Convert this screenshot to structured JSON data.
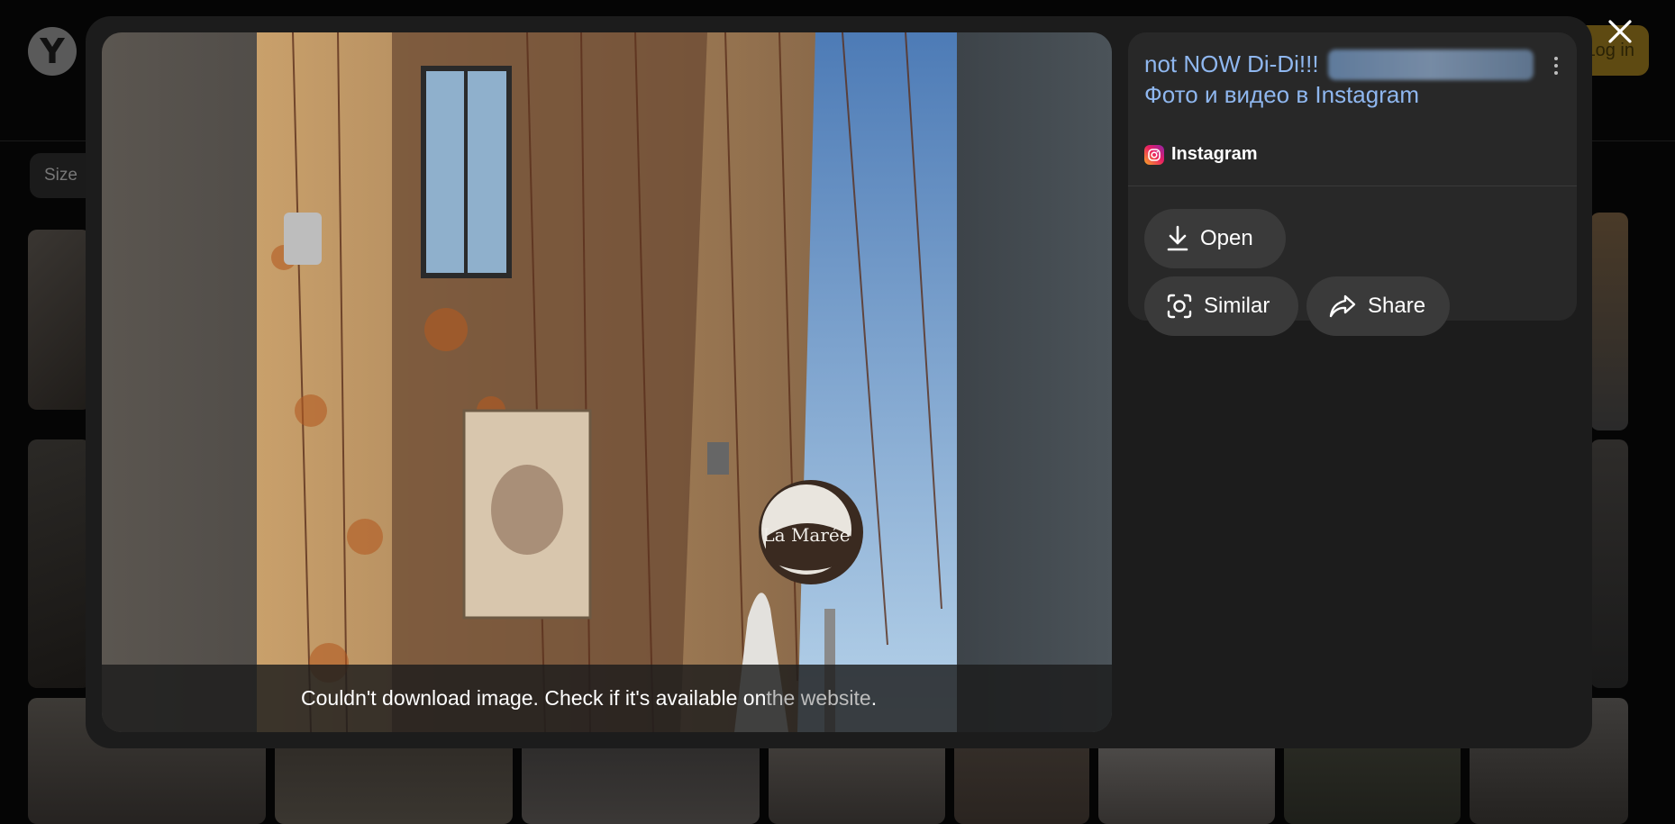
{
  "background": {
    "logo_letter": "Y",
    "size_chip": "Size",
    "login_label": "Log in"
  },
  "viewer": {
    "error_text": "Couldn't download image. Check if it's available on ",
    "error_link": "the website",
    "error_tail": ".",
    "photo_sign_text": "La Marée"
  },
  "info": {
    "title": "not NOW Di-Di!!!",
    "subtitle": "Фото и видео в Instagram",
    "source": "Instagram"
  },
  "actions": {
    "open": "Open",
    "similar": "Similar",
    "share": "Share"
  },
  "colors": {
    "link": "#8fb7ef",
    "pill": "#3a3a3a",
    "panel": "#282828",
    "modal": "#1c1c1c"
  }
}
